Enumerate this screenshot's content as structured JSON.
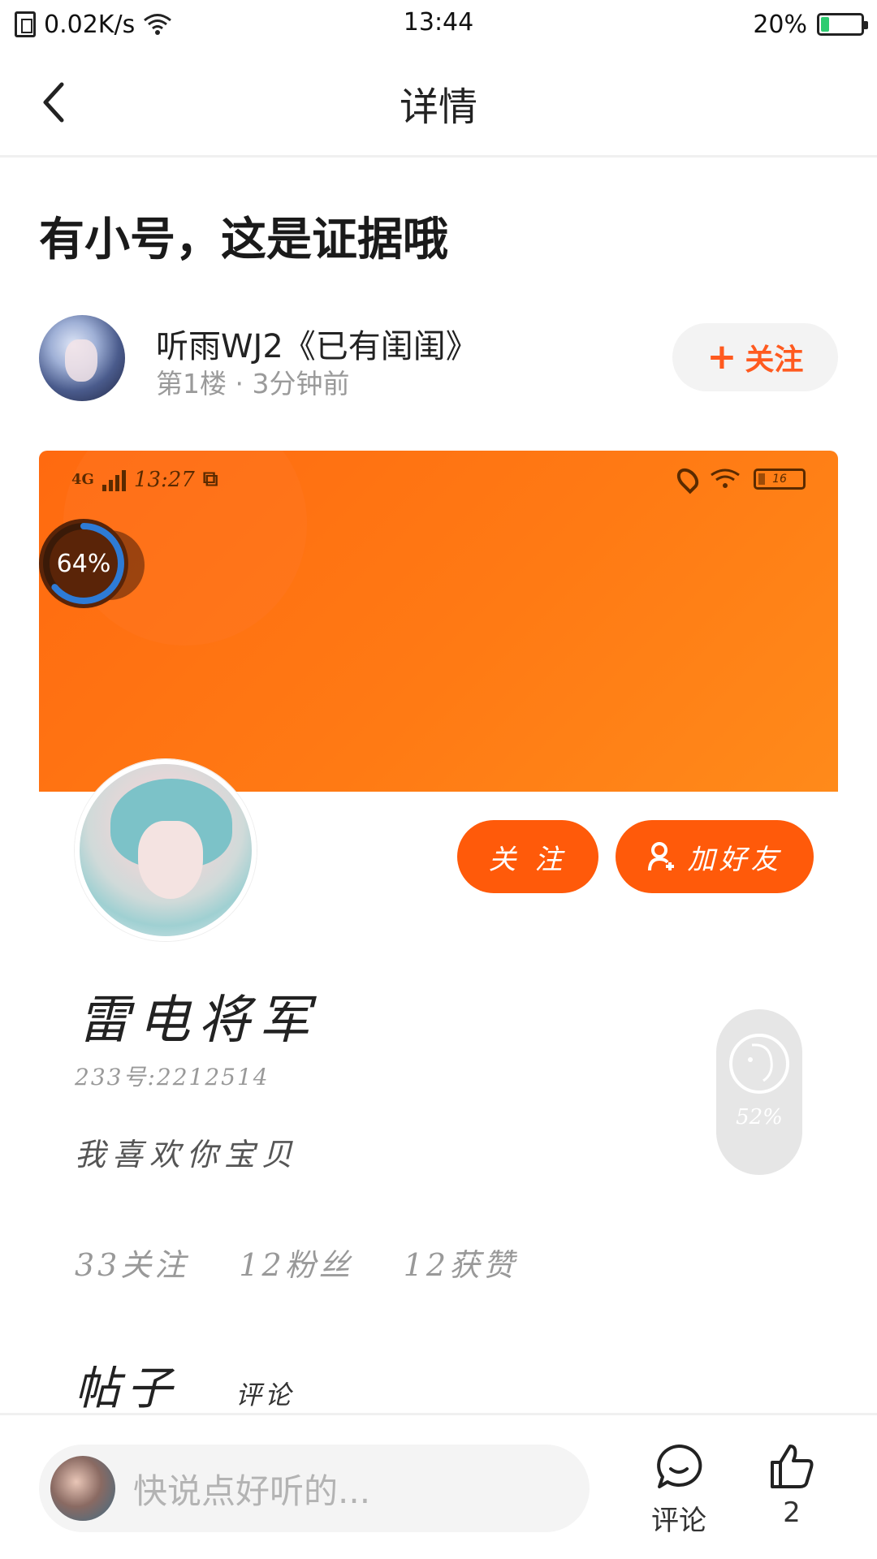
{
  "status_bar": {
    "network_speed": "0.02K/s",
    "time": "13:44",
    "battery": "20%",
    "battery_level": 0.2
  },
  "nav": {
    "title": "详情"
  },
  "post": {
    "title": "有小号，这是证据哦",
    "author": {
      "name": "听雨WJ2《已有闺闺》",
      "meta": "第1楼 · 3分钟前",
      "follow_label": "关注"
    }
  },
  "screenshot": {
    "status_time": "13:27",
    "network": "4G",
    "battery_text": "16",
    "progress_label": "64%",
    "progress_value": 0.64,
    "follow_label": "关 注",
    "add_friend_label": "加好友",
    "nickname": "雷电将军",
    "uid": "233号:2212514",
    "bio": "我喜欢你宝贝",
    "stats": [
      "33关注",
      "12粉丝",
      "12获赞"
    ],
    "tabs": {
      "posts": "帖子",
      "comments": "评论"
    },
    "float_label": "52%"
  },
  "bottom_bar": {
    "placeholder": "快说点好听的...",
    "comment_label": "评论",
    "like_count": "2"
  },
  "colors": {
    "accent": "#ff5a1f",
    "banner": "#ff7a14"
  }
}
